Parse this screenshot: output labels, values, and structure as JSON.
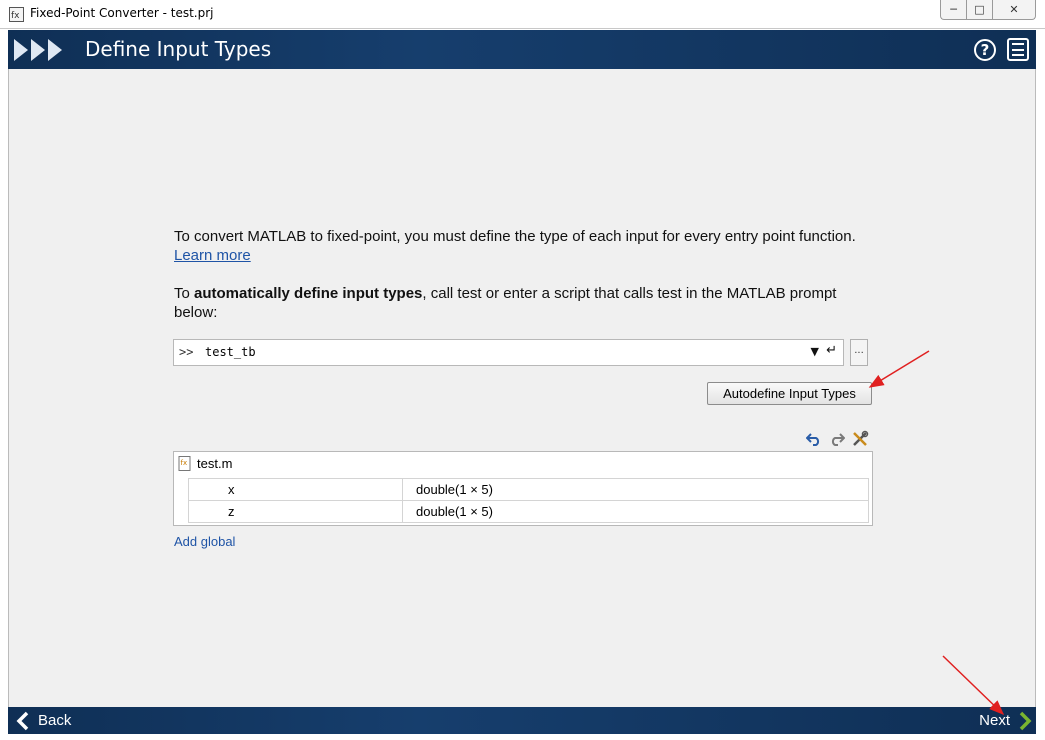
{
  "window": {
    "title": "Fixed-Point Converter - test.prj",
    "controls": {
      "minimize": "─",
      "maximize": "□",
      "close": "✕"
    }
  },
  "header": {
    "title": "Define Input Types",
    "icons": [
      "chevrons-icon",
      "help-icon",
      "menu-icon"
    ]
  },
  "intro": {
    "line": "To convert MATLAB to fixed-point, you must define the type of each input for every entry point function.",
    "link": "Learn more"
  },
  "auto": {
    "prefix": "To ",
    "bold": "automatically define input types",
    "suffix": ", call test or enter a script that calls test in the MATLAB prompt below:"
  },
  "command": {
    "prompt": ">>",
    "value": "test_tb",
    "dropdown": "▼",
    "enter": "↵",
    "browse": "..."
  },
  "autodefine_button": "Autodefine Input Types",
  "toolbar_icons": [
    "undo-icon",
    "redo-icon",
    "tools-icon"
  ],
  "types": {
    "file": "test.m",
    "rows": [
      {
        "name": "x",
        "type": "double(1 × 5)"
      },
      {
        "name": "z",
        "type": "double(1 × 5)"
      }
    ]
  },
  "add_global": "Add global",
  "footer": {
    "back": "Back",
    "next": "Next"
  },
  "colors": {
    "header_bg": "#163e6d",
    "link": "#1f54a6",
    "next_arrow": "#79b530",
    "annotation": "#e02020"
  }
}
